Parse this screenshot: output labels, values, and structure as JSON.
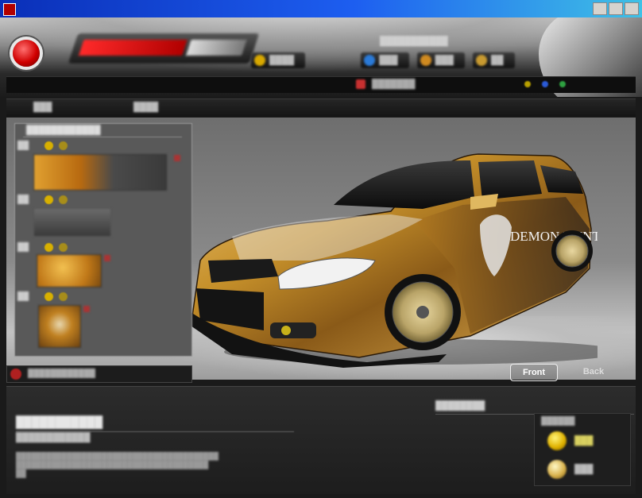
{
  "window": {
    "title": " "
  },
  "views": {
    "front_label": "Front",
    "back_label": "Back"
  },
  "car": {
    "livery_text": "DEMON HUNTER"
  },
  "colors": {
    "title_bar": "#1d5ef0",
    "accent_red": "#d00000",
    "coin_gold": "#e0b200",
    "car_paint": "#c6902a"
  },
  "icons": {
    "close_button": "red-round-button-icon",
    "coin": "coin-icon",
    "flame": "flame-texture-icon"
  }
}
